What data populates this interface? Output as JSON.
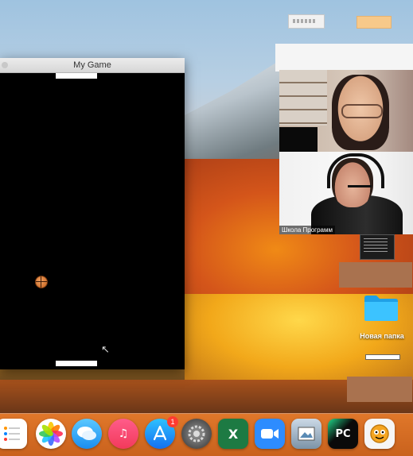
{
  "game_window": {
    "title": "My Game"
  },
  "video_call": {
    "participant_2_name": "Школа Программ"
  },
  "desktop": {
    "folder_label": "Новая папка"
  },
  "dock": {
    "app_store_badge": "1",
    "icons": [
      "reminders-icon",
      "photos-icon",
      "messages-icon",
      "music-icon",
      "app-store-icon",
      "system-preferences-icon",
      "excel-icon",
      "zoom-icon",
      "preview-icon",
      "pycharm-icon",
      "scratch-icon"
    ]
  }
}
